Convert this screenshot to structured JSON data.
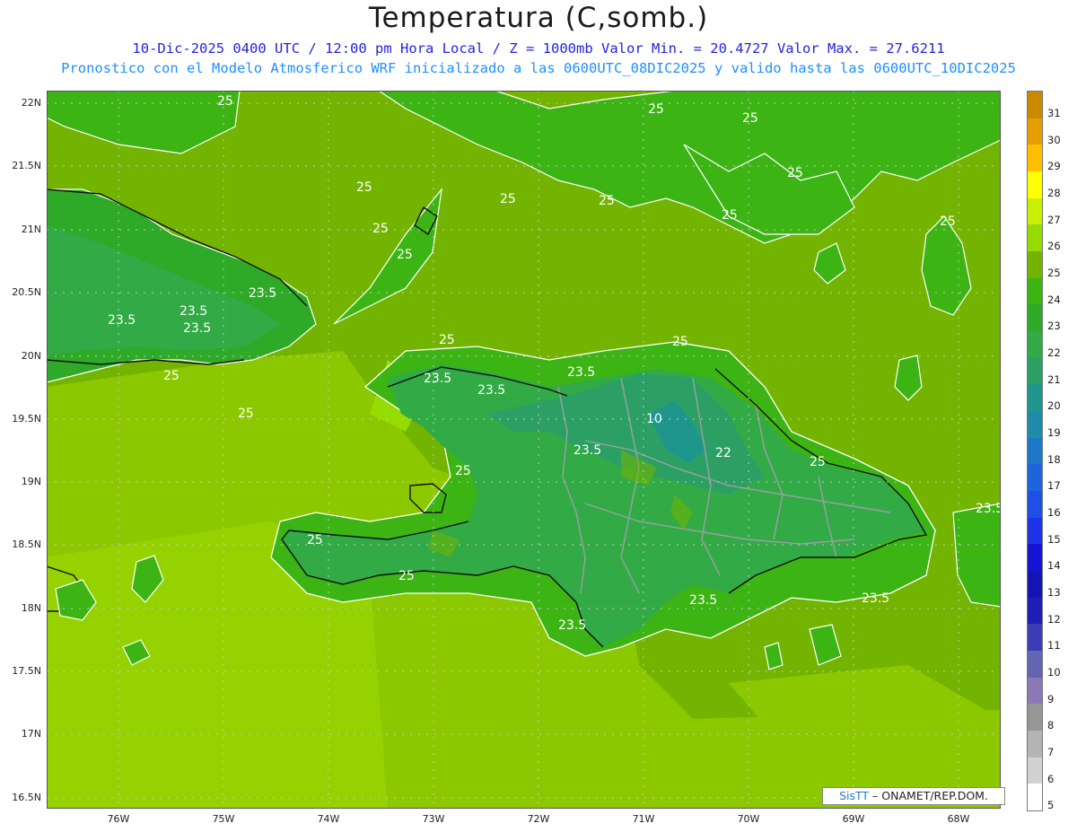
{
  "title": "Temperatura (C,somb.)",
  "subtitle_1": "10-Dic-2025 0400 UTC / 12:00 pm Hora Local / Z = 1000mb  Valor Min. = 20.4727  Valor Max. = 27.6211",
  "subtitle_2": "Pronostico con el Modelo Atmosferico WRF inicializado a las 0600UTC_08DIC2025 y valido hasta las  0600UTC_10DIC2025",
  "lat_labels": [
    "22N",
    "21.5N",
    "21N",
    "20.5N",
    "20N",
    "19.5N",
    "19N",
    "18.5N",
    "18N",
    "17.5N",
    "17N",
    "16.5N"
  ],
  "lon_labels": [
    "76W",
    "75W",
    "74W",
    "73W",
    "72W",
    "71W",
    "70W",
    "69W",
    "68W"
  ],
  "colorbar": {
    "labels": [
      "31",
      "30",
      "29",
      "28",
      "27",
      "26",
      "25",
      "24",
      "23",
      "22",
      "21",
      "20",
      "19",
      "18",
      "17",
      "16",
      "15",
      "14",
      "13",
      "12",
      "11",
      "10",
      "9",
      "8",
      "7",
      "6",
      "5"
    ],
    "colors": [
      "#c98a00",
      "#e69e00",
      "#ffbf00",
      "#ffff00",
      "#c8f000",
      "#96dc00",
      "#73b400",
      "#3cb414",
      "#2eaa28",
      "#32aa46",
      "#2ca064",
      "#1e968c",
      "#1e8ca8",
      "#1e78c8",
      "#1e64dc",
      "#1e50e6",
      "#1e32e6",
      "#1414d2",
      "#1414b4",
      "#1e1eb4",
      "#3c3cb4",
      "#6464b4",
      "#8c78b4",
      "#969696",
      "#b4b4b4",
      "#d2d2d2",
      "#ffffff"
    ]
  },
  "contour_labels": [
    "25",
    "25",
    "25",
    "25",
    "25",
    "25",
    "25",
    "25",
    "25",
    "25",
    "25",
    "25",
    "25",
    "25",
    "25",
    "25",
    "25",
    "25",
    "25",
    "23.5",
    "23.5",
    "23.5",
    "23.5",
    "23.5",
    "23.5",
    "23.5",
    "23.5",
    "23.5",
    "23.5",
    "23.5",
    "23.5",
    "22",
    "10"
  ],
  "credit": {
    "brand": "SisTT",
    "rest": "– ONAMET/REP.DOM."
  }
}
